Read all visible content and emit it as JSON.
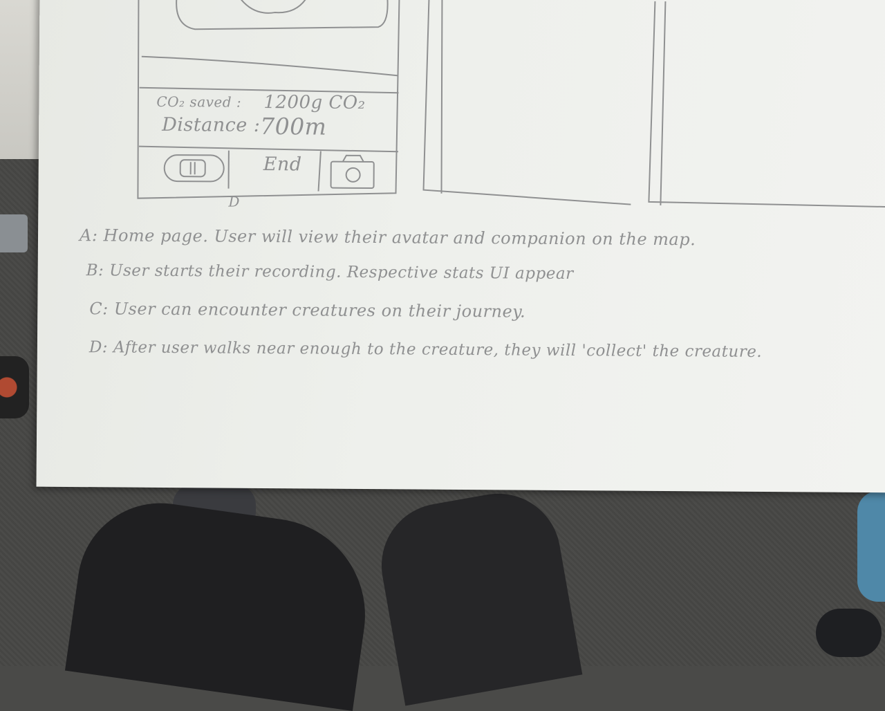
{
  "wireframe": {
    "stats": {
      "co2_label": "CO₂ saved :",
      "co2_value": "1200g CO₂",
      "distance_label": "Distance :",
      "distance_value": "700m"
    },
    "controls": {
      "pause_icon": "pause-icon",
      "end_label": "End",
      "camera_icon": "camera-icon"
    },
    "frame_label": "D"
  },
  "notes": [
    "A: Home page. User will view their avatar and companion on the map.",
    "B: User starts their recording. Respective stats UI appear",
    "C: User can encounter creatures on their journey.",
    "D: After user walks near enough to the creature, they will 'collect' the creature."
  ],
  "colors": {
    "paper": "#eef0ec",
    "pencil": "#8f9091",
    "carpet": "#4a4a48"
  }
}
